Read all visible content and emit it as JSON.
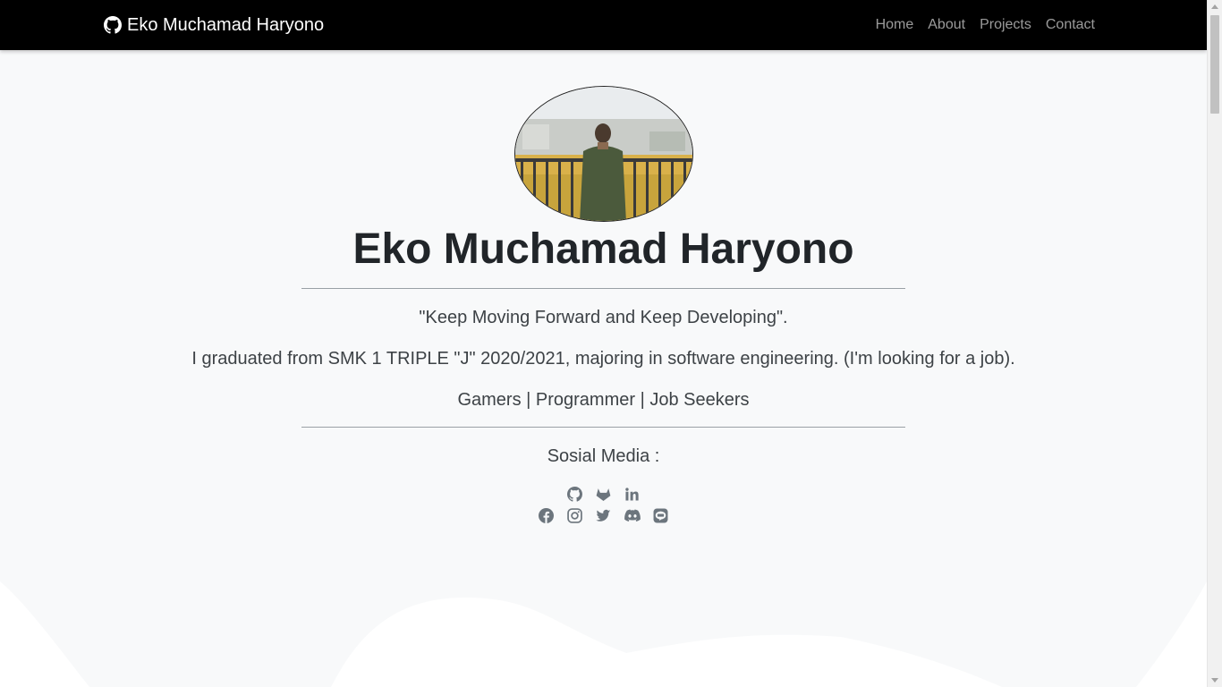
{
  "navbar": {
    "brand": "Eko Muchamad Haryono",
    "links": [
      "Home",
      "About",
      "Projects",
      "Contact"
    ]
  },
  "hero": {
    "name": "Eko Muchamad Haryono",
    "quote": "\"Keep Moving Forward and Keep Developing\".",
    "bio": "I graduated from SMK 1 TRIPLE \"J\" 2020/2021, majoring in software engineering. (I'm looking for a job).",
    "tags": "Gamers | Programmer | Job Seekers",
    "social_title": "Sosial Media :"
  },
  "social": {
    "row1": [
      "github-icon",
      "gitlab-icon",
      "linkedin-icon"
    ],
    "row2": [
      "facebook-icon",
      "instagram-icon",
      "twitter-icon",
      "discord-icon",
      "line-icon"
    ]
  },
  "colors": {
    "navbar_bg": "#000000",
    "page_bg": "#f8f9fa",
    "text": "#212529",
    "icon": "#6c757d"
  }
}
